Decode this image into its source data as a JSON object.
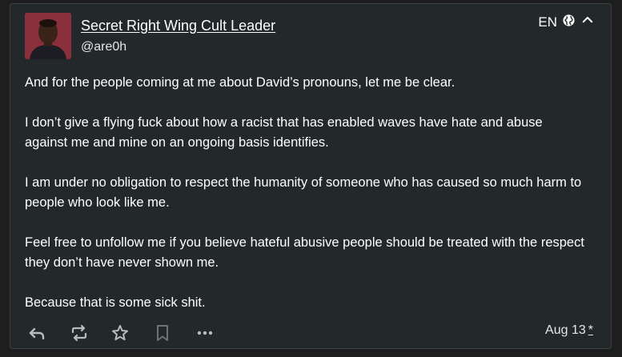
{
  "author": {
    "display_name": "Secret Right Wing Cult Leader",
    "handle": "@are0h"
  },
  "header": {
    "language": "EN",
    "visibility_icon": "globe-icon",
    "collapse_icon": "chevron-up-icon"
  },
  "status": {
    "paragraphs": [
      "And for the people coming at me about David’s pronouns, let me be clear.",
      "I don’t give a flying fuck about how a racist that has enabled waves have hate and abuse against me and mine on an ongoing basis identifies.",
      "I am under no obligation to respect the humanity of someone who has caused so much harm to people who look like me.",
      "Feel free to unfollow me if you believe hateful abusive people should be treated with the respect they don’t have never shown me.",
      "Because that is some sick shit."
    ]
  },
  "actions": {
    "items": [
      "reply-icon",
      "boost-icon",
      "favourite-icon",
      "bookmark-icon",
      "more-icon"
    ],
    "date": "Aug 13",
    "edited_marker": "*"
  },
  "colors": {
    "background": "#1e1e1e",
    "card": "#23282b",
    "text": "#ffffff",
    "icon": "#b9bcbf",
    "bookmark_icon": "#6e7377"
  }
}
